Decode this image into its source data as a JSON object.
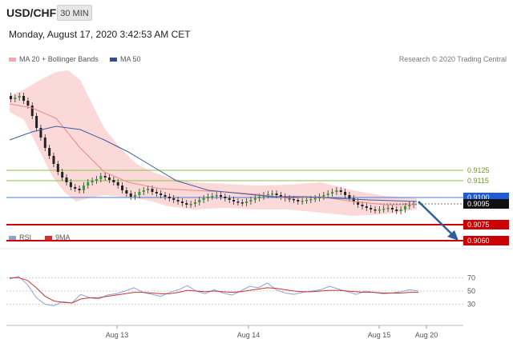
{
  "header": {
    "symbol": "USD/CHF",
    "timeframe": "30 MIN",
    "datetime": "Monday, August 17, 2020 3:42:53 AM CET"
  },
  "legend": {
    "ma20_bollinger": "MA 20 + Bollinger Bands",
    "ma50": "MA 50",
    "credit": "Research © 2020 Trading Central"
  },
  "rsi_legend": {
    "rsi": "RSI",
    "ma9": "9MA"
  },
  "colors": {
    "bollinger": "#f9c9c9",
    "ma50": "#3b5f9e",
    "green_level": "#8fbf4f",
    "blue_level": "#4a7fd6",
    "red_level": "#cc0000",
    "arrow": "#2f5f9f",
    "rsi": "#8ba3d9",
    "ma9": "#cc3333"
  },
  "chart_data": [
    {
      "type": "line",
      "title": "USD/CHF 30 MIN",
      "x": [
        "Aug 13",
        "Aug 14",
        "Aug 15",
        "Aug 20"
      ],
      "levels": [
        {
          "label": "0.9125",
          "kind": "resistance"
        },
        {
          "label": "0.9115",
          "kind": "resistance"
        },
        {
          "label": "0.9100",
          "kind": "pivot"
        },
        {
          "label": "0.9095",
          "kind": "current"
        },
        {
          "label": "0.9075",
          "kind": "support"
        },
        {
          "label": "0.9060",
          "kind": "support"
        }
      ],
      "series": [
        {
          "name": "MA 20 + Bollinger Bands"
        },
        {
          "name": "MA 50"
        }
      ]
    },
    {
      "type": "line",
      "title": "RSI",
      "y_ticks": [
        "70",
        "50",
        "30"
      ],
      "ylim": [
        20,
        80
      ],
      "series": [
        {
          "name": "RSI",
          "values": [
            68,
            72,
            60,
            40,
            30,
            28,
            34,
            32,
            45,
            40,
            38,
            44,
            46,
            50,
            55,
            48,
            45,
            42,
            48,
            52,
            58,
            50,
            46,
            52,
            47,
            44,
            50,
            57,
            55,
            62,
            52,
            47,
            45,
            48,
            50,
            52,
            57,
            53,
            49,
            45,
            50,
            48,
            46,
            47,
            49,
            52,
            50
          ]
        },
        {
          "name": "9MA",
          "values": [
            70,
            70,
            66,
            55,
            42,
            35,
            33,
            32,
            38,
            40,
            40,
            42,
            44,
            46,
            48,
            48,
            47,
            46,
            46,
            48,
            51,
            50,
            49,
            50,
            49,
            48,
            49,
            51,
            53,
            55,
            54,
            52,
            50,
            49,
            49,
            50,
            51,
            51,
            50,
            49,
            48,
            48,
            47,
            47,
            47,
            48,
            48
          ]
        }
      ]
    }
  ]
}
